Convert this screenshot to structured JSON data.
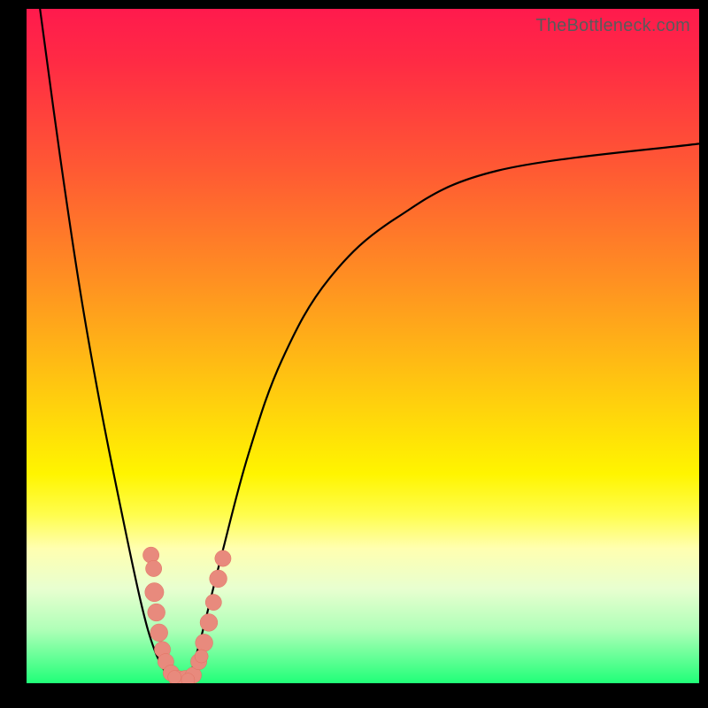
{
  "watermark": "TheBottleneck.com",
  "colors": {
    "frame_border": "#000000",
    "curve": "#000000",
    "dot_fill": "#e88a7d",
    "dot_stroke": "#e27060",
    "gradient_top": "#ff1a4d",
    "gradient_bottom": "#20ff78"
  },
  "chart_data": {
    "type": "line",
    "title": "",
    "xlabel": "",
    "ylabel": "",
    "xlim": [
      0,
      100
    ],
    "ylim": [
      0,
      100
    ],
    "grid": false,
    "left_curve": {
      "note": "curve descending from top-left toward trough near x≈21",
      "x": [
        2,
        5,
        8,
        11,
        14,
        17,
        19,
        21,
        22
      ],
      "y": [
        100,
        78,
        58,
        41,
        26,
        12,
        5,
        1,
        0
      ]
    },
    "right_curve": {
      "note": "curve rising from trough near x≈24 toward top-right, flattening near y≈80",
      "x": [
        24,
        26,
        29,
        33,
        38,
        45,
        55,
        70,
        100
      ],
      "y": [
        0,
        7,
        19,
        34,
        48,
        60,
        69,
        76,
        80
      ]
    },
    "dots": {
      "note": "scatter cluster of points near the trough, roughly along both curve legs",
      "points": [
        {
          "x": 18.5,
          "y": 19.0,
          "r": 1.2
        },
        {
          "x": 18.9,
          "y": 17.0,
          "r": 1.2
        },
        {
          "x": 19.0,
          "y": 13.5,
          "r": 1.4
        },
        {
          "x": 19.3,
          "y": 10.5,
          "r": 1.3
        },
        {
          "x": 19.7,
          "y": 7.5,
          "r": 1.3
        },
        {
          "x": 20.2,
          "y": 5.0,
          "r": 1.2
        },
        {
          "x": 20.7,
          "y": 3.2,
          "r": 1.2
        },
        {
          "x": 21.5,
          "y": 1.5,
          "r": 1.2
        },
        {
          "x": 22.5,
          "y": 0.6,
          "r": 1.3
        },
        {
          "x": 23.6,
          "y": 0.6,
          "r": 1.3
        },
        {
          "x": 24.8,
          "y": 1.2,
          "r": 1.2
        },
        {
          "x": 25.6,
          "y": 3.2,
          "r": 1.2
        },
        {
          "x": 26.4,
          "y": 6.0,
          "r": 1.3
        },
        {
          "x": 27.1,
          "y": 9.0,
          "r": 1.3
        },
        {
          "x": 27.8,
          "y": 12.0,
          "r": 1.2
        },
        {
          "x": 28.5,
          "y": 15.5,
          "r": 1.3
        },
        {
          "x": 29.2,
          "y": 18.5,
          "r": 1.2
        },
        {
          "x": 26.0,
          "y": 4.0,
          "r": 1.0
        },
        {
          "x": 22.0,
          "y": 0.9,
          "r": 1.0
        },
        {
          "x": 24.0,
          "y": 0.5,
          "r": 1.0
        }
      ]
    }
  }
}
